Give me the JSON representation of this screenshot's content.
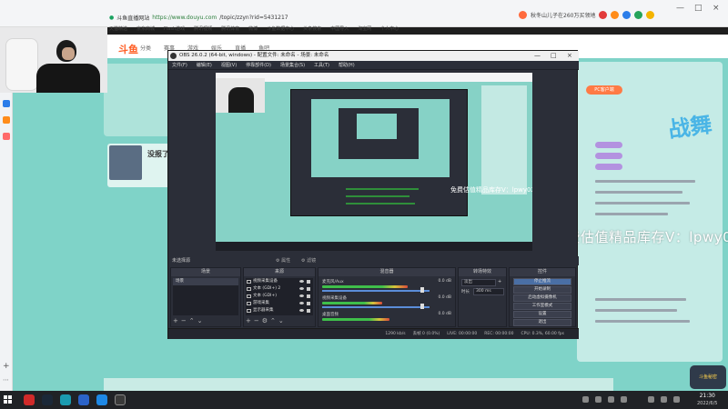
{
  "browser": {
    "site_name": "斗鱼直播网站",
    "url_host": "https://www.douyu.com",
    "url_path": "/topic/zzyn?rid=5431217",
    "bookmarks": [
      "天猫精选",
      "京东商城",
      "Flash游戏",
      "腾讯视频",
      "腾讯体育",
      "微博",
      "斗鱼数据中心",
      "头条搜索",
      "中国导入",
      "淘宝网",
      "个人中心"
    ],
    "news_ticker": "秋冬山儿子在260万买领地",
    "window_controls": [
      "—",
      "□",
      "×"
    ]
  },
  "page": {
    "logo": "斗鱼",
    "nav": [
      "分类",
      "赛事",
      "游戏",
      "娱乐",
      "直播",
      "鱼吧"
    ],
    "card_title": "没报了",
    "promo_badge": "PC客户端",
    "side_logo": "战舞",
    "watermark": "免费估值精品库存V：lpwy02",
    "sticker_text": "斗鱼秘密"
  },
  "obs": {
    "title": "OBS 26.0.2 (64-bit, windows) - 配置文件: 未命名 - 场景: 未命名",
    "menu": [
      "文件(F)",
      "编辑(E)",
      "视图(V)",
      "停靠部件(D)",
      "场景集合(S)",
      "工具(T)",
      "帮助(H)"
    ],
    "preview_watermark": "免费估值精品库存V：lpwy02",
    "dock_status": "未选择源",
    "properties_label": "属性",
    "filters_label": "滤镜",
    "docks": {
      "scenes": "场景",
      "sources": "来源",
      "mixer": "混音器",
      "transitions": "转场特效",
      "controls": "控件"
    },
    "scenes": [
      "场景"
    ],
    "sources": [
      {
        "name": "视频采集设备",
        "icon": "camera-icon"
      },
      {
        "name": "文本 (GDI+) 2",
        "icon": "text-icon"
      },
      {
        "name": "文本 (GDI+)",
        "icon": "text-icon"
      },
      {
        "name": "游戏采集",
        "icon": "gamepad-icon"
      },
      {
        "name": "显示器采集",
        "icon": "monitor-icon"
      }
    ],
    "mixer": [
      {
        "name": "麦克风/Aux",
        "db": "0.0 dB",
        "level": 0.78
      },
      {
        "name": "视频采集设备",
        "db": "0.0 dB",
        "level": 0.55
      },
      {
        "name": "桌面音频",
        "db": "0.0 dB",
        "level": 0.62
      }
    ],
    "transition": {
      "type": "淡出",
      "duration_label": "时长",
      "duration": "300 ms"
    },
    "controls": [
      "停止推流",
      "开始录制",
      "启动虚拟摄像机",
      "工作室模式",
      "设置",
      "退出"
    ],
    "status": {
      "dropped": "丢帧 0 (0.0%)",
      "live": "LIVE: 00:00:00",
      "rec": "REC: 00:00:00",
      "cpu": "CPU: 0.3%, 60.00 fps",
      "kbps": "1290 kb/s"
    },
    "colors": {
      "panel": "#2b2e38",
      "accent": "#4a6fa5",
      "meter": "#3fbf4a"
    }
  },
  "taskbar": {
    "time": "21:30",
    "date": "2022/6/5",
    "apps": [
      "media-player-icon",
      "steam-icon",
      "app-teal-icon",
      "app-blue-icon",
      "edge-icon",
      "obs-icon"
    ]
  }
}
